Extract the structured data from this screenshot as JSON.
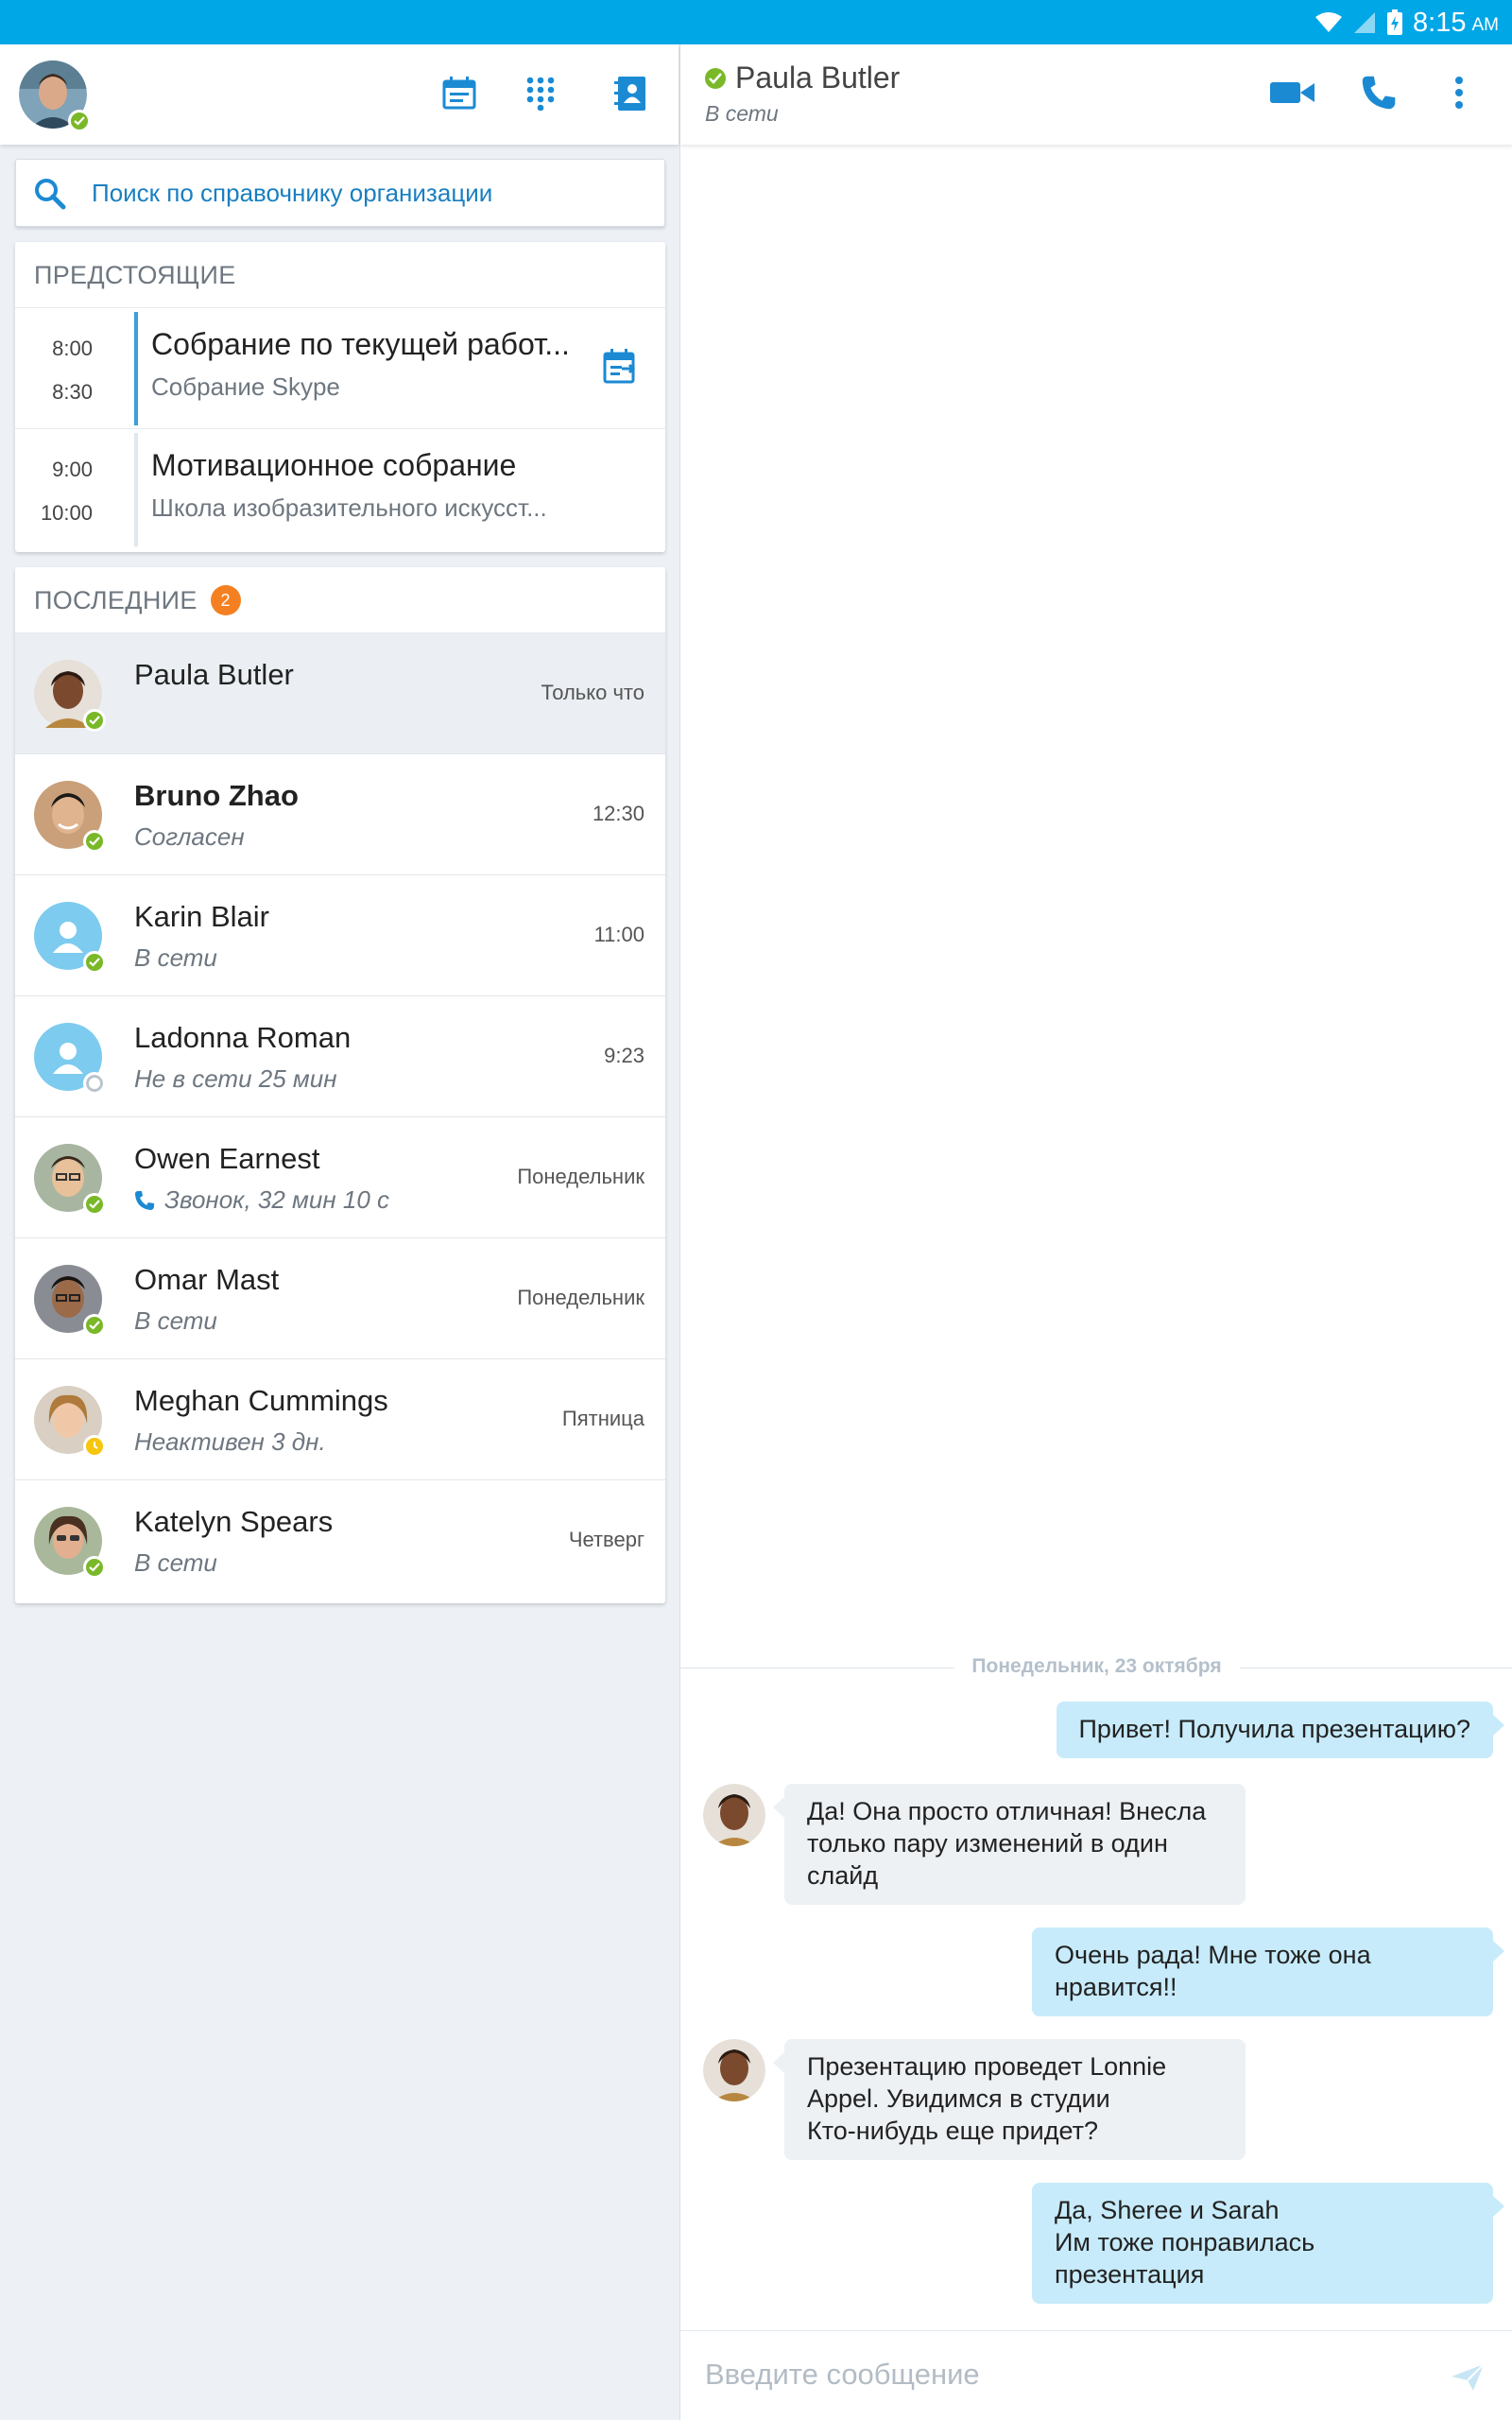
{
  "status_bar": {
    "time": "8:15",
    "ampm": "AM",
    "icons": [
      "wifi-icon",
      "signal-icon",
      "battery-icon"
    ]
  },
  "left_header": {
    "icons": [
      "meetings-icon",
      "dialpad-icon",
      "contacts-icon"
    ],
    "accent": "#1b8ad3"
  },
  "search": {
    "placeholder": "Поиск по справочнику организации"
  },
  "upcoming": {
    "title": "ПРЕДСТОЯЩИЕ",
    "meetings": [
      {
        "start": "8:00",
        "end": "8:30",
        "title": "Собрание по текущей работ...",
        "subtitle": "Собрание Skype",
        "active": true
      },
      {
        "start": "9:00",
        "end": "10:00",
        "title": "Мотивационное собрание",
        "subtitle": "Школа изобразительного искусст...",
        "active": false
      }
    ]
  },
  "recent": {
    "title": "ПОСЛЕДНИЕ",
    "badge": "2",
    "contacts": [
      {
        "name": "Paula Butler",
        "status": "",
        "time": "Только что",
        "presence": "online",
        "selected": true,
        "bold": false
      },
      {
        "name": "Bruno Zhao",
        "status": "Согласен",
        "time": "12:30",
        "presence": "online",
        "selected": false,
        "bold": true
      },
      {
        "name": "Karin Blair",
        "status": "В сети",
        "time": "11:00",
        "presence": "online",
        "selected": false,
        "bold": false
      },
      {
        "name": "Ladonna Roman",
        "status": "Не в сети 25 мин",
        "time": "9:23",
        "presence": "offline",
        "selected": false,
        "bold": false
      },
      {
        "name": "Owen Earnest",
        "status": "Звонок, 32 мин 10 с",
        "time": "Понедельник",
        "presence": "online",
        "selected": false,
        "bold": false,
        "call": true
      },
      {
        "name": "Omar Mast",
        "status": "В сети",
        "time": "Понедельник",
        "presence": "online",
        "selected": false,
        "bold": false
      },
      {
        "name": "Meghan Cummings",
        "status": "Неактивен 3 дн.",
        "time": "Пятница",
        "presence": "away",
        "selected": false,
        "bold": false
      },
      {
        "name": "Katelyn Spears",
        "status": "В сети",
        "time": "Четверг",
        "presence": "online",
        "selected": false,
        "bold": false
      }
    ]
  },
  "conversation": {
    "name": "Paula Butler",
    "status": "В сети",
    "date_separator": "Понедельник, 23 октября",
    "messages": [
      {
        "dir": "out",
        "lines": [
          "Привет! Получила презентацию?"
        ]
      },
      {
        "dir": "in",
        "lines": [
          "Да! Она просто отличная! Внесла",
          "только пару изменений в один",
          "слайд"
        ]
      },
      {
        "dir": "out",
        "lines": [
          "Очень рада! Мне тоже она",
          "нравится!!"
        ]
      },
      {
        "dir": "in",
        "lines": [
          "Презентацию проведет Lonnie",
          "Appel. Увидимся в студии",
          "Кто-нибудь еще придет?"
        ]
      },
      {
        "dir": "out",
        "lines": [
          "Да, Sheree и Sarah",
          "Им тоже понравилась",
          "презентация"
        ]
      }
    ],
    "composer_placeholder": "Введите сообщение"
  },
  "colors": {
    "status_bar": "#00a7e7",
    "online": "#7ab828",
    "away": "#f6c50e",
    "badge": "#f48021",
    "outgoing_bubble": "#c7ebfa",
    "incoming_bubble": "#eef1f4"
  }
}
